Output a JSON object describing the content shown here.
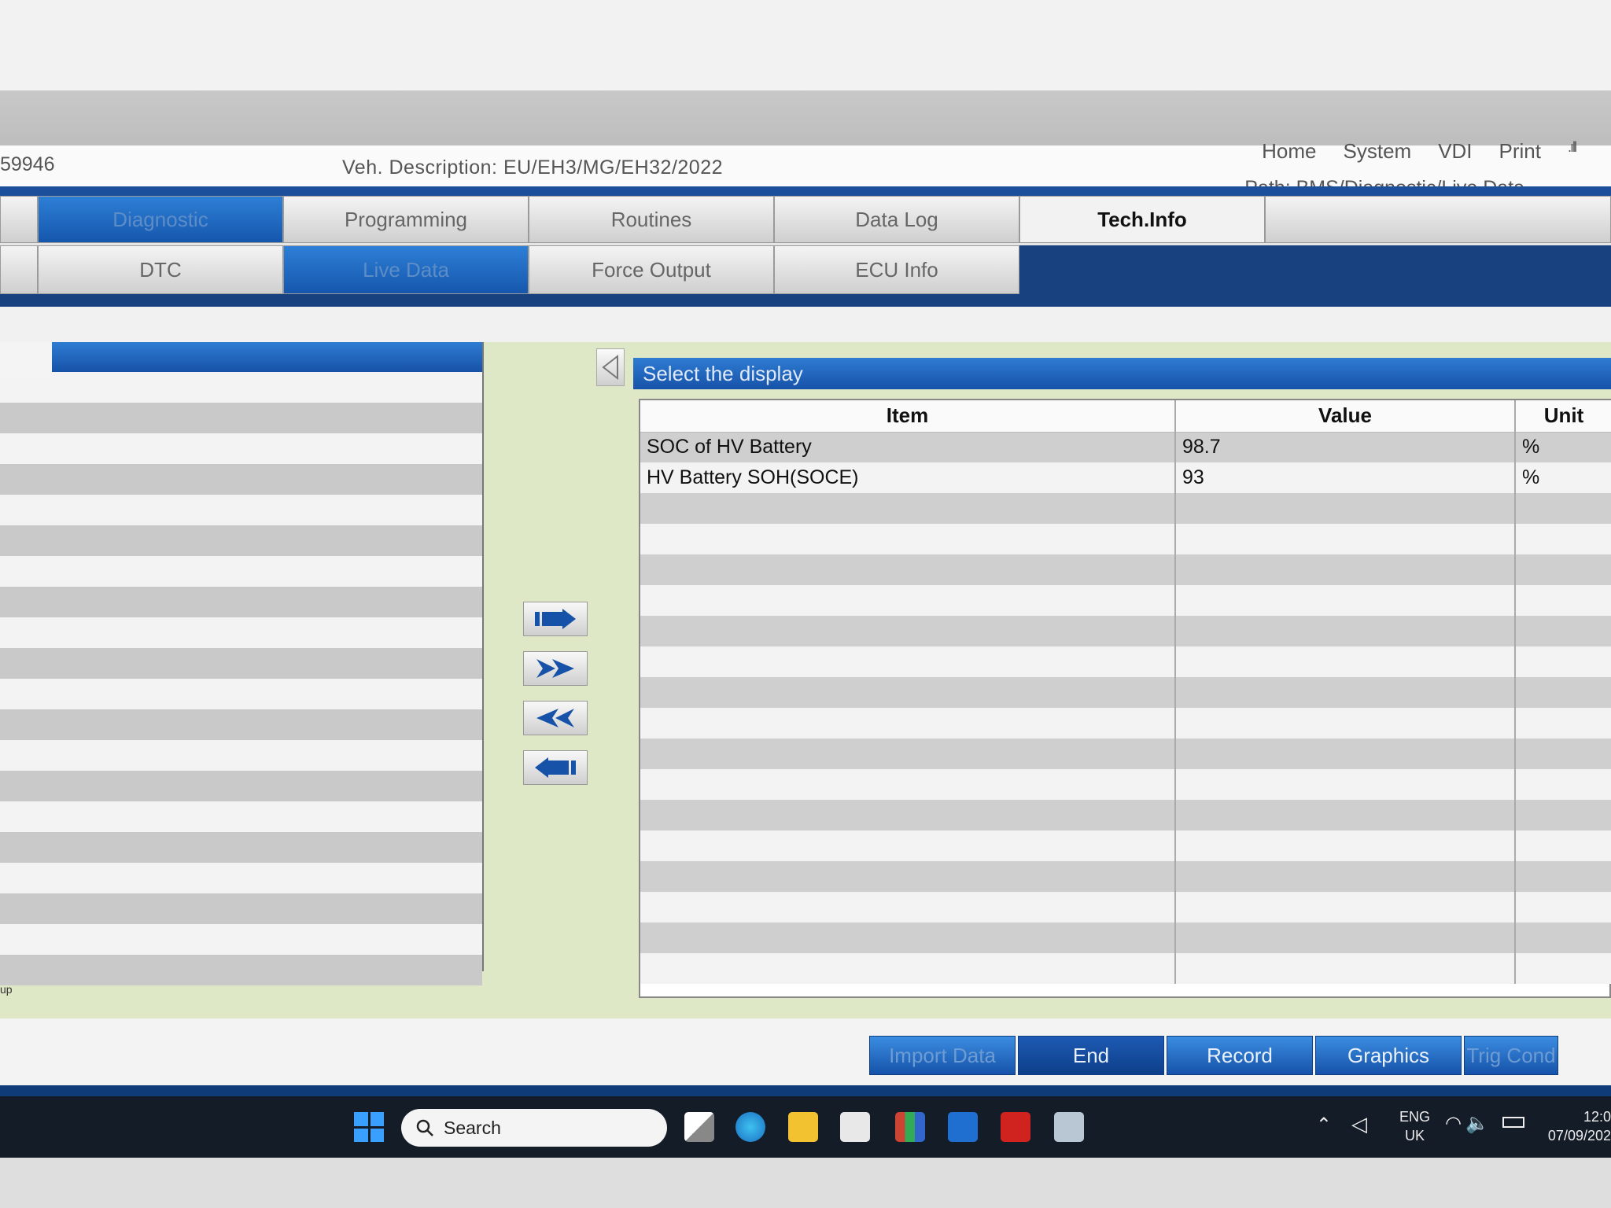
{
  "header": {
    "vin_fragment": "59946",
    "veh_description_label": "Veh. Description:",
    "veh_description_value": "EU/EH3/MG/EH32/2022",
    "menu": [
      "Home",
      "System",
      "VDI",
      "Print"
    ],
    "path_label": "Path:",
    "path_value": "BMS/Diagnostic/Live Data"
  },
  "tabs_row1": [
    {
      "label": "Diagnostic",
      "active": true
    },
    {
      "label": "Programming"
    },
    {
      "label": "Routines"
    },
    {
      "label": "Data Log"
    },
    {
      "label": "Tech.Info",
      "bold": true
    }
  ],
  "tabs_row2": [
    {
      "label": "DTC"
    },
    {
      "label": "Live Data",
      "active": true
    },
    {
      "label": "Force Output"
    },
    {
      "label": "ECU Info"
    }
  ],
  "left_panel": {
    "footer_text": "up"
  },
  "right_panel": {
    "title": "Select the display",
    "columns": [
      "Item",
      "Value",
      "Unit"
    ],
    "rows": [
      {
        "item": "SOC of HV Battery",
        "value": "98.7",
        "unit": "%"
      },
      {
        "item": "HV Battery SOH(SOCE)",
        "value": "93",
        "unit": "%"
      }
    ]
  },
  "bottom_buttons": [
    {
      "label": "Import Data",
      "disabled": true
    },
    {
      "label": "End",
      "end": true
    },
    {
      "label": "Record"
    },
    {
      "label": "Graphics"
    },
    {
      "label": "Trig Cond",
      "disabled": true
    }
  ],
  "taskbar": {
    "search_label": "Search",
    "lang_line1": "ENG",
    "lang_line2": "UK",
    "time": "12:0",
    "date": "07/09/202"
  },
  "colors": {
    "accent_blue": "#1b4f9c",
    "tab_active": "#1557ad",
    "workspace_bg": "#dfe8c6"
  }
}
